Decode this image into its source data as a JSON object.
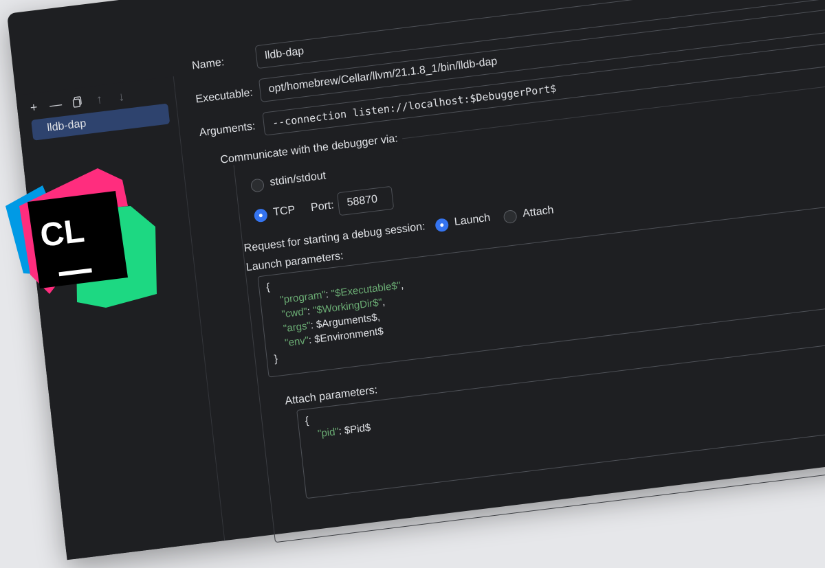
{
  "toolbar": {
    "add_icon": "+",
    "remove_icon": "—",
    "copy_icon": "copy-icon",
    "move_up_icon": "↑",
    "move_down_icon": "↓"
  },
  "configurations": [
    {
      "name": "lldb-dap"
    }
  ],
  "form": {
    "name_label": "Name:",
    "name_value": "lldb-dap",
    "executable_label": "Executable:",
    "executable_value": "opt/homebrew/Cellar/llvm/21.1.8_1/bin/lldb-dap",
    "arguments_label": "Arguments:",
    "arguments_value": "--connection listen://localhost:$DebuggerPort$",
    "communicate_label": "Communicate with the debugger via:",
    "stdio_label": "stdin/stdout",
    "tcp_label": "TCP",
    "port_label": "Port:",
    "port_value": "58870",
    "request_label": "Request for starting a debug session:",
    "launch_label": "Launch",
    "attach_label": "Attach",
    "launch_params_label": "Launch parameters:",
    "attach_params_label": "Attach parameters:"
  },
  "selected": {
    "communication": "TCP",
    "request": "Launch"
  },
  "launch_params": {
    "open": "{",
    "lines": [
      {
        "key": "\"program\"",
        "sep": ": ",
        "value": "\"$Executable$\"",
        "tail": ","
      },
      {
        "key": "\"cwd\"",
        "sep": ": ",
        "value": "\"$WorkingDir$\"",
        "tail": ","
      },
      {
        "key": "\"args\"",
        "sep": ": ",
        "value": "$Arguments$",
        "tail": ","
      },
      {
        "key": "\"env\"",
        "sep": ": ",
        "value": "$Environment$",
        "tail": ""
      }
    ],
    "close": "}"
  },
  "attach_params": {
    "open": "{",
    "lines": [
      {
        "key": "\"pid\"",
        "sep": ": ",
        "value": "$Pid$",
        "tail": ""
      }
    ]
  },
  "logo": {
    "text": "CL",
    "colors": {
      "pink": "#ff2d7e",
      "blue": "#009ae5",
      "green": "#1dd882",
      "black": "#000000"
    }
  },
  "colors": {
    "background": "#e6e7ea",
    "window": "#1e1f22",
    "selection": "#2e436e",
    "accent": "#3574f0",
    "code_key": "#6aab73"
  }
}
